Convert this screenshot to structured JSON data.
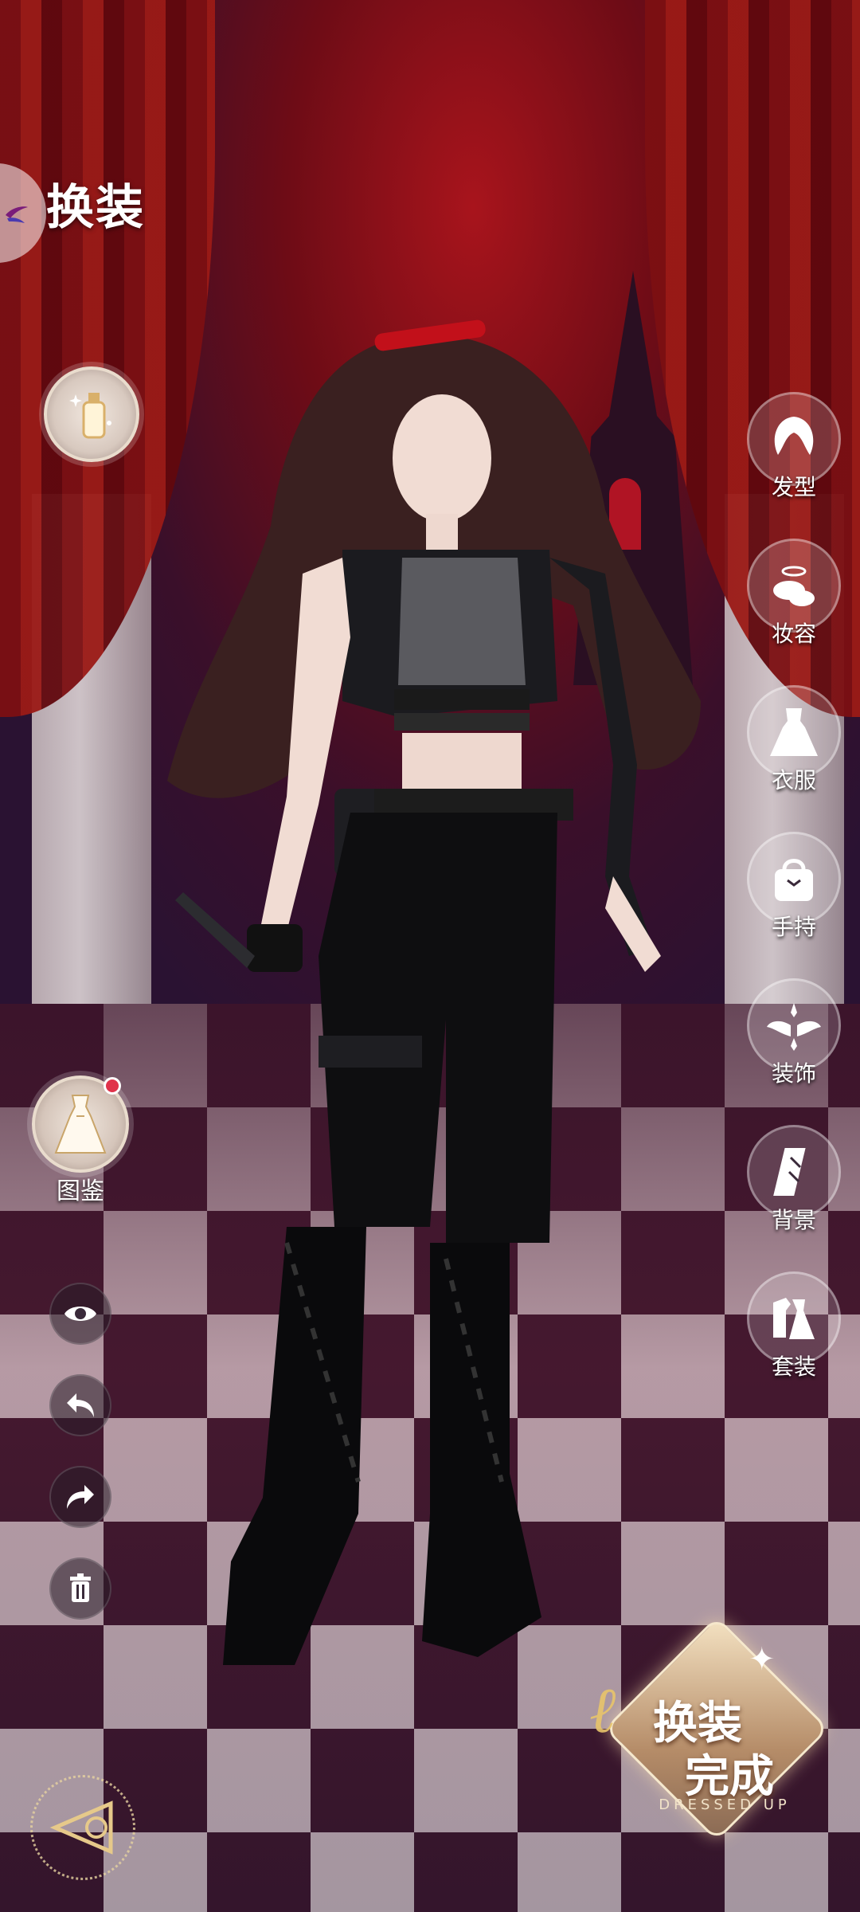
{
  "header": {
    "title": "换装"
  },
  "left_panel": {
    "gallery_label": "图鉴"
  },
  "right_menu": [
    {
      "label": "发型",
      "icon": "hair-icon"
    },
    {
      "label": "妆容",
      "icon": "makeup-icon"
    },
    {
      "label": "衣服",
      "icon": "dress-icon"
    },
    {
      "label": "手持",
      "icon": "handbag-icon"
    },
    {
      "label": "装饰",
      "icon": "wings-icon"
    },
    {
      "label": "背景",
      "icon": "background-icon"
    },
    {
      "label": "套装",
      "icon": "outfit-set-icon"
    }
  ],
  "done_button": {
    "line1": "换装",
    "line2": "完成",
    "subtitle": "DRESSED UP"
  },
  "colors": {
    "accent_gold": "#e8c56b",
    "sky_red": "#a8141c",
    "curtain_red": "#7c0f12"
  }
}
